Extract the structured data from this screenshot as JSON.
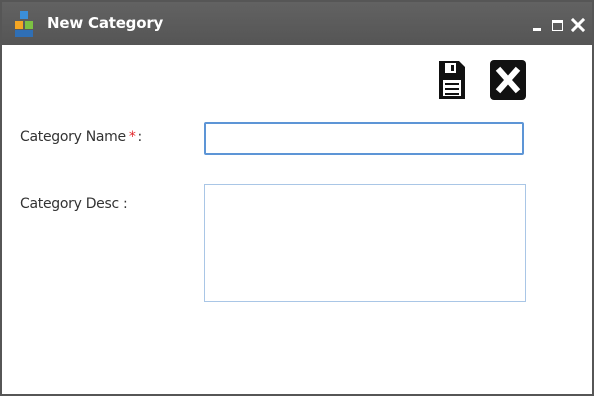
{
  "window": {
    "title": "New Category",
    "icons": {
      "app": "app-logo-icon",
      "minimize": "minimize-icon",
      "maximize": "maximize-icon",
      "close": "close-icon"
    }
  },
  "toolbar": {
    "save_icon": "save-icon",
    "cancel_icon": "cancel-icon"
  },
  "form": {
    "category_name": {
      "label": "Category Name",
      "required_mark": "*",
      "suffix": ":",
      "value": ""
    },
    "category_desc": {
      "label": "Category Desc :",
      "value": ""
    }
  },
  "colors": {
    "titlebar": "#565656",
    "required": "#e1262b",
    "input_focus_border": "#5d95d6",
    "textarea_border": "#a9c6e6"
  }
}
